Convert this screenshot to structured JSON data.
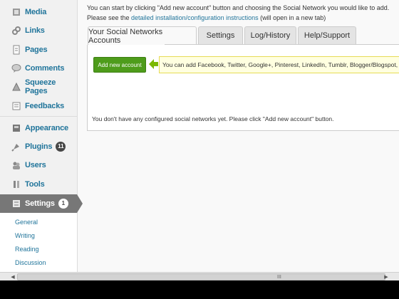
{
  "sidebar": {
    "media": "Media",
    "links": "Links",
    "pages": "Pages",
    "comments": "Comments",
    "squeeze_pages": "Squeeze Pages",
    "feedbacks": "Feedbacks",
    "appearance": "Appearance",
    "plugins": "Plugins",
    "plugins_badge": "11",
    "users": "Users",
    "tools": "Tools",
    "settings": "Settings",
    "settings_badge": "1",
    "submenu": [
      "General",
      "Writing",
      "Reading",
      "Discussion"
    ]
  },
  "intro": {
    "line1": "You can start by clicking \"Add new account\" button and choosing the Social Network you would like to add.",
    "line2_prefix": "Please see the ",
    "line2_link": "detailed installation/configuration instructions",
    "line2_suffix": " (will open in a new tab)"
  },
  "tabs": [
    "Your Social Networks Accounts",
    "Settings",
    "Log/History",
    "Help/Support"
  ],
  "panel": {
    "add_button": "Add new account",
    "hint": "You can add Facebook, Twitter, Google+, Pinterest, LinkedIn, Tumblr, Blogger/Blogspot, Delicious",
    "empty_message": "You don't have any configured social networks yet. Please click \"Add new account\" button."
  },
  "scrollbar": {
    "grip": "III"
  },
  "colors": {
    "accent": "#21759b",
    "button_green": "#4e9c1b",
    "hint_bg": "#ffffe0",
    "hint_arrow": "#7ab800"
  }
}
